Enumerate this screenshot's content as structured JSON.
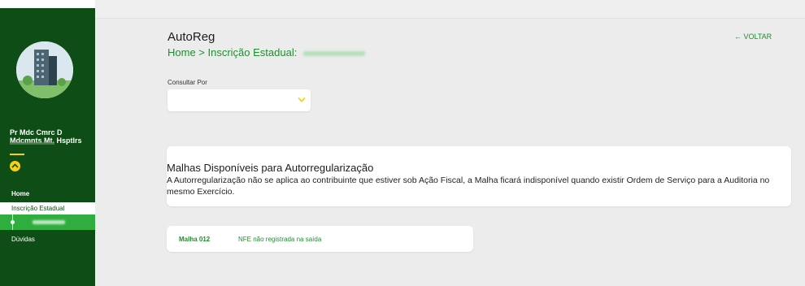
{
  "sidebar": {
    "company_name": "Pr Mdc Cmrc D Mdcmnts Mt. Hsptlrs",
    "nav": {
      "home": "Home",
      "inscricao": "Inscrição Estadual",
      "duvidas": "Dúvidas"
    }
  },
  "header": {
    "title": "AutoReg",
    "breadcrumb": "Home > Inscrição Estadual:",
    "back_label": "← VOLTAR"
  },
  "filter": {
    "label": "Consultar Por",
    "selected_value": ""
  },
  "info_card": {
    "title": "Malhas Disponíveis para Autorregularização",
    "text": "A Autorregularização não se aplica ao contribuinte que estiver sob Ação Fiscal, a Malha ficará indisponível quando existir Ordem de Serviço para a Auditoria no mesmo Exercício."
  },
  "malhas": [
    {
      "code": "Malha 012",
      "description": "NFE não registrada na saída"
    }
  ],
  "colors": {
    "sidebar": "#0f4d16",
    "accent_green": "#2fae3f",
    "accent_yellow": "#f3d117",
    "link_green": "#1f8f2e"
  },
  "icons": [
    "company-avatar-icon",
    "chevron-down-icon",
    "arrow-left-icon"
  ]
}
